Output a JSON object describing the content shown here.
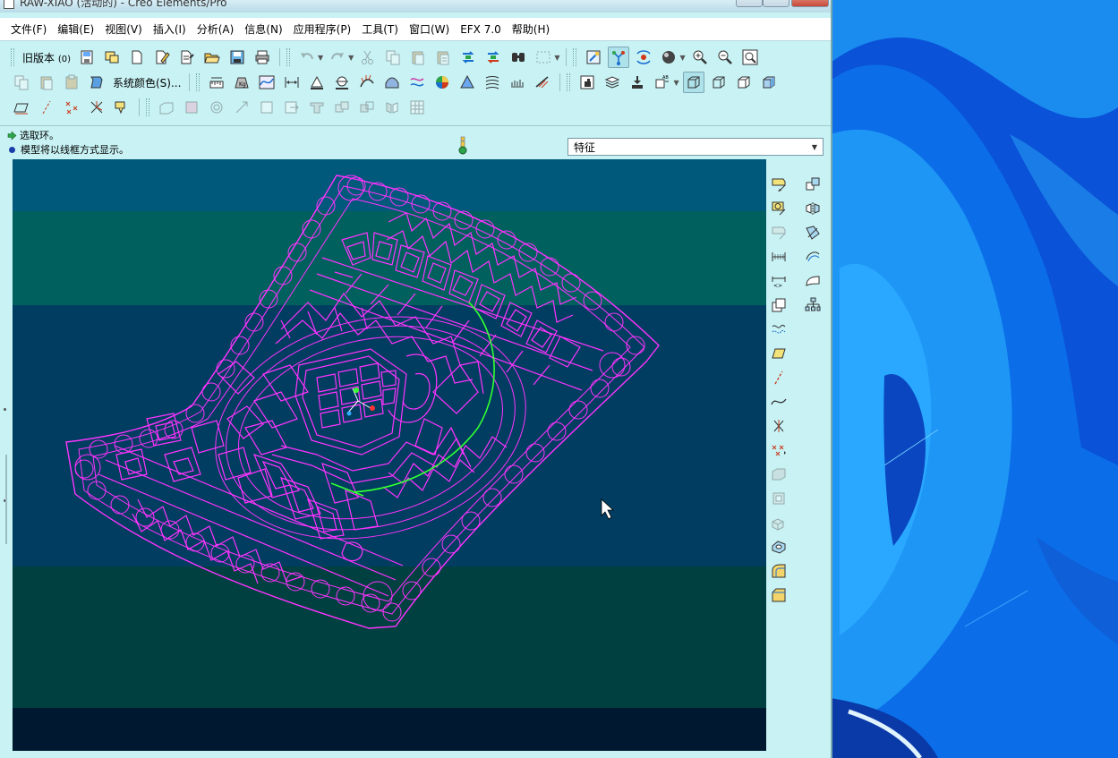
{
  "window": {
    "title": "RAW-XIAO (活动的) - Creo Elements/Pro"
  },
  "menubar": {
    "items": [
      {
        "id": "file",
        "label": "文件(F)"
      },
      {
        "id": "edit",
        "label": "编辑(E)"
      },
      {
        "id": "view",
        "label": "视图(V)"
      },
      {
        "id": "insert",
        "label": "插入(I)"
      },
      {
        "id": "analysis",
        "label": "分析(A)"
      },
      {
        "id": "info",
        "label": "信息(N)"
      },
      {
        "id": "applications",
        "label": "应用程序(P)"
      },
      {
        "id": "tools",
        "label": "工具(T)"
      },
      {
        "id": "window",
        "label": "窗口(W)"
      },
      {
        "id": "efx",
        "label": "EFX 7.0"
      },
      {
        "id": "help",
        "label": "帮助(H)"
      }
    ]
  },
  "toolbar": {
    "old_version_label": "旧版本",
    "old_version_count": "(0)",
    "system_colors_label": "系统颜色(S)..."
  },
  "messages": {
    "line1": "选取环。",
    "line2": "模型将以线框方式显示。"
  },
  "filter": {
    "selected": "特征"
  },
  "colors": {
    "window_bg": "#c8f2f4",
    "wireframe": "#ff33ff",
    "selection_edge": "#33ff33",
    "viewport_bands": [
      "#00587a",
      "#00605e",
      "#003d60",
      "#004040",
      "#001830"
    ]
  }
}
